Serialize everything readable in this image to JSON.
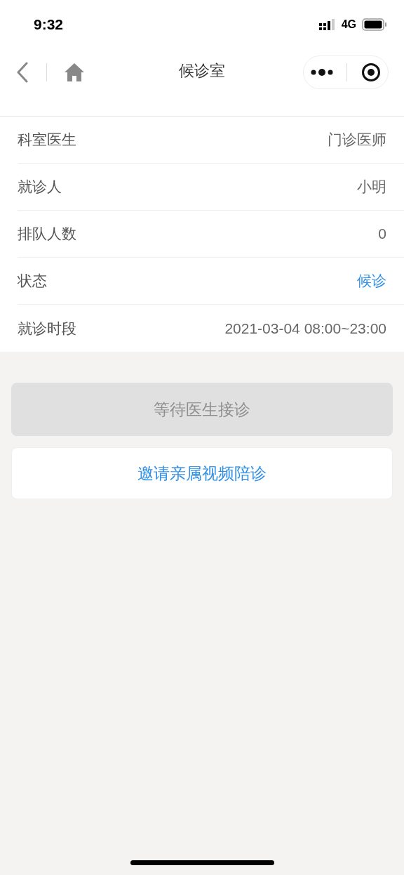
{
  "status_bar": {
    "time": "9:32",
    "network": "4G"
  },
  "nav": {
    "title": "候诊室"
  },
  "rows": [
    {
      "label": "科室医生",
      "value": "门诊医师",
      "kind": "plain"
    },
    {
      "label": "就诊人",
      "value": "小明",
      "kind": "plain"
    },
    {
      "label": "排队人数",
      "value": "0",
      "kind": "plain"
    },
    {
      "label": "状态",
      "value": "候诊",
      "kind": "status"
    },
    {
      "label": "就诊时段",
      "value": "2021-03-04 08:00~23:00",
      "kind": "plain"
    }
  ],
  "buttons": [
    {
      "label": "等待医生接诊",
      "disabled": true
    },
    {
      "label": "邀请亲属视频陪诊",
      "disabled": false
    }
  ]
}
